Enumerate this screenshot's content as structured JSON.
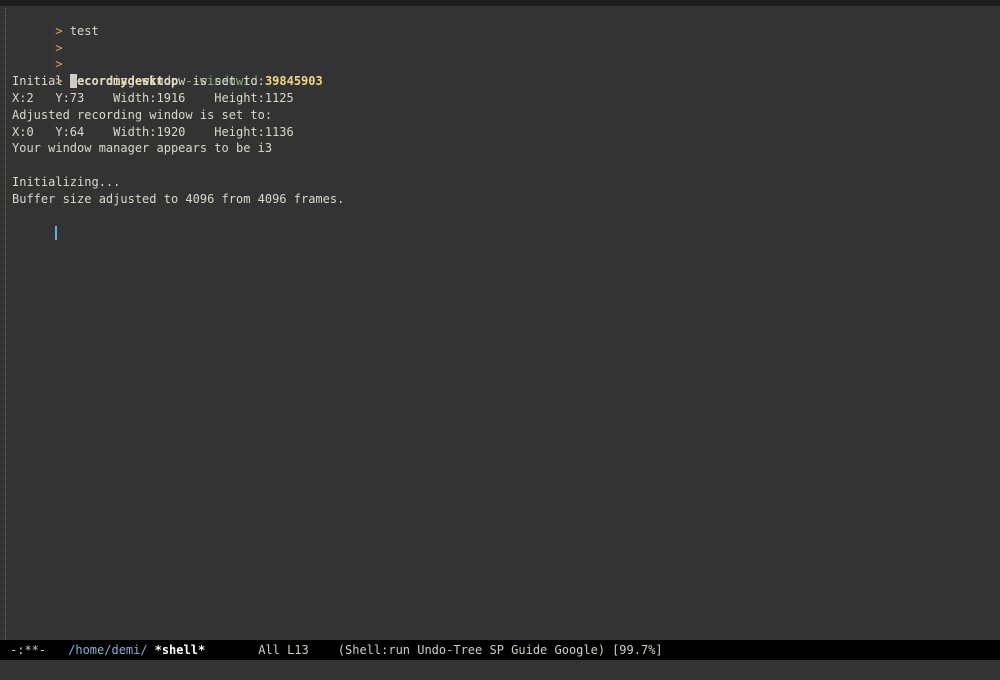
{
  "terminal": {
    "lines": [
      {
        "prompt": ">",
        "text": "test"
      },
      {
        "prompt": ">",
        "text": ""
      },
      {
        "prompt": ">",
        "text": ""
      }
    ],
    "command": {
      "prompt": ">",
      "first_char": "r",
      "name_rest": "ecordmydesktop",
      "flag": "--windowid",
      "window_id": "39845903"
    },
    "output": [
      "Initial recording window is set to:",
      "X:2   Y:73    Width:1916    Height:1125",
      "Adjusted recording window is set to:",
      "X:0   Y:64    Width:1920    Height:1136",
      "Your window manager appears to be i3",
      "",
      "Initializing...",
      "Buffer size adjusted to 4096 from 4096 frames."
    ]
  },
  "modeline": {
    "status": "-:**-",
    "directory": "/home/demi/",
    "buffer_name": "*shell*",
    "position": "All L13",
    "modes": "(Shell:run Undo-Tree SP Guide Google)",
    "battery": "[99.7%]"
  }
}
